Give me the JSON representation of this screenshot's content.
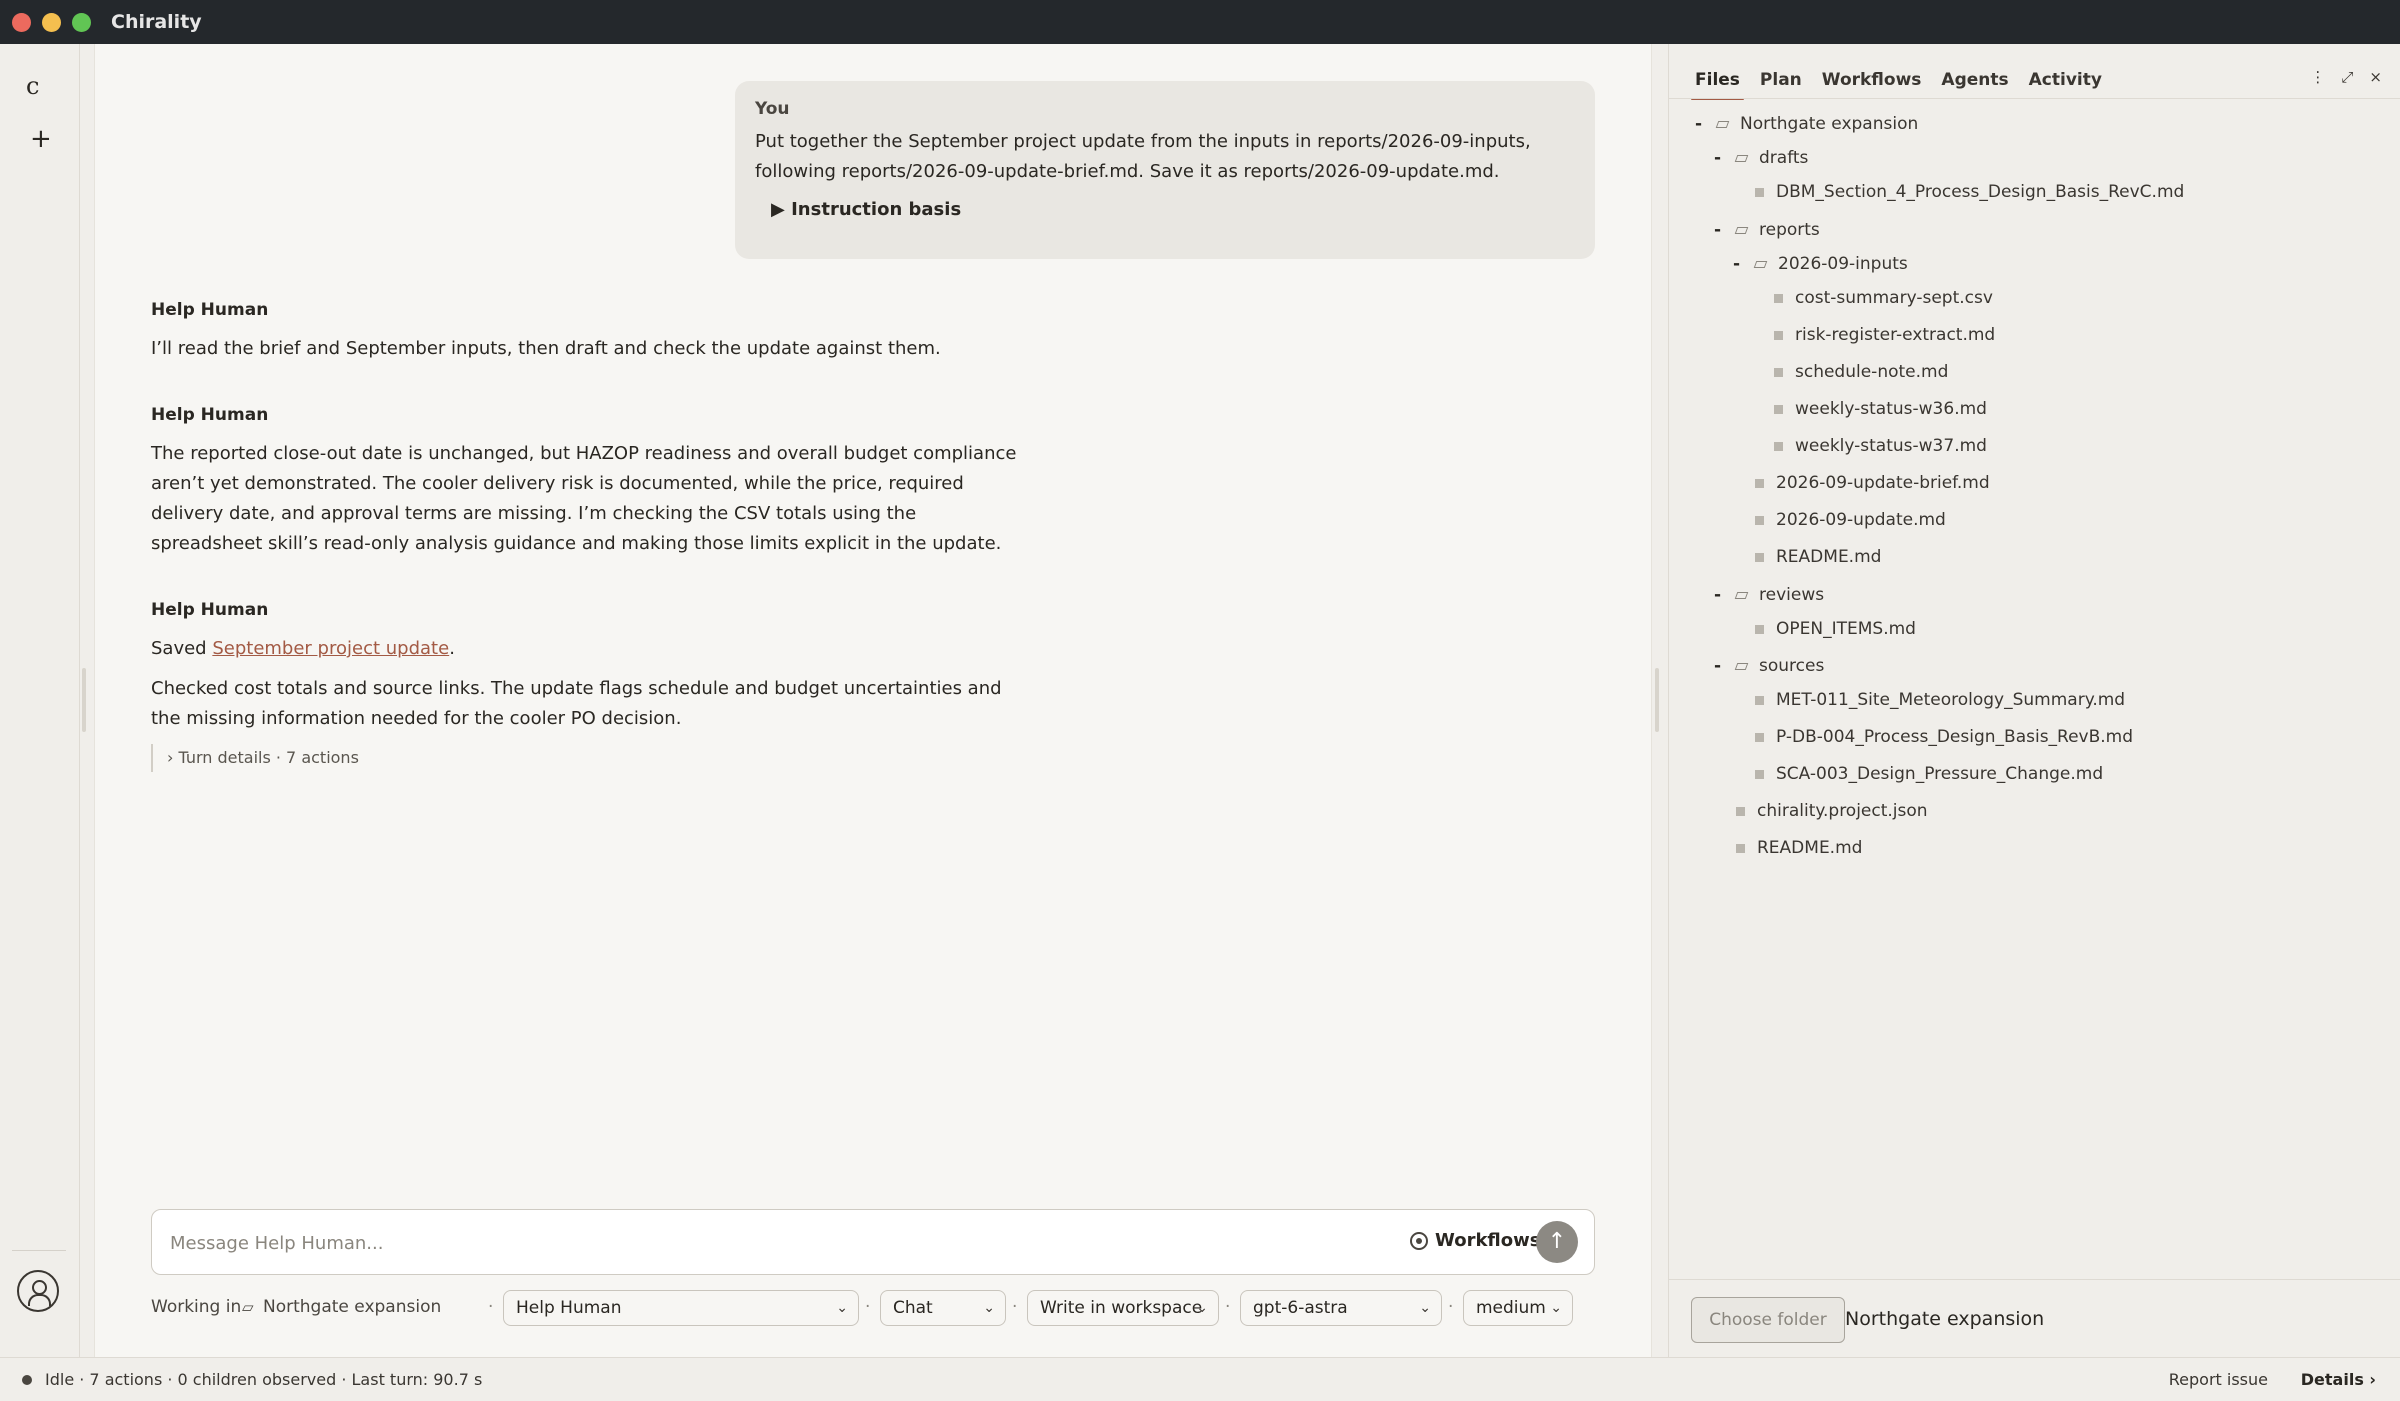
{
  "app": {
    "title": "Chirality"
  },
  "rail": {
    "logo": "ϲ",
    "new": "+"
  },
  "chat": {
    "user": {
      "name": "You",
      "text": "Put together the September project update from the inputs in reports/2026-09-inputs, following reports/2026-09-update-brief.md. Save it as reports/2026-09-update.md.",
      "basis": "▶ Instruction basis"
    },
    "messages": [
      {
        "name": "Help Human",
        "text": "I’ll read the brief and September inputs, then draft and check the update against them."
      },
      {
        "name": "Help Human",
        "text": "The reported close-out date is unchanged, but HAZOP readiness and overall budget compliance aren’t yet demonstrated. The cooler delivery risk is documented, while the price, required delivery date, and approval terms are missing. I’m checking the CSV totals using the spreadsheet skill’s read-only analysis guidance and making those limits explicit in the update."
      },
      {
        "name": "Help Human",
        "saved_prefix": "Saved ",
        "saved_link": "September project update",
        "saved_suffix": ".",
        "text": "Checked cost totals and source links. The update flags schedule and budget uncertainties and the missing information needed for the cooler PO decision.",
        "details": "›  Turn details · 7 actions"
      }
    ]
  },
  "composer": {
    "placeholder": "Message Help Human...",
    "workflows": "Workflows",
    "send": "↑"
  },
  "controls": {
    "working_in_label": "Working in",
    "project_icon": "▱",
    "project": "Northgate expansion",
    "agent": "Help Human",
    "mode": "Chat",
    "permission": "Write in workspace",
    "model": "gpt-6-astra",
    "effort": "medium",
    "separator": "·"
  },
  "panel": {
    "tabs": [
      {
        "label": "Files",
        "active": true
      },
      {
        "label": "Plan"
      },
      {
        "label": "Workflows"
      },
      {
        "label": "Agents"
      },
      {
        "label": "Activity"
      }
    ],
    "icons": {
      "more": "⋮",
      "expand": "⤢",
      "close": "×"
    },
    "tree": [
      {
        "label": "Northgate expansion",
        "type": "folder",
        "depth": 0
      },
      {
        "label": "drafts",
        "type": "folder",
        "depth": 1
      },
      {
        "label": "DBM_Section_4_Process_Design_Basis_RevC.md",
        "type": "file",
        "depth": 2
      },
      {
        "label": "reports",
        "type": "folder",
        "depth": 1
      },
      {
        "label": "2026-09-inputs",
        "type": "folder",
        "depth": 2
      },
      {
        "label": "cost-summary-sept.csv",
        "type": "file",
        "depth": 3
      },
      {
        "label": "risk-register-extract.md",
        "type": "file",
        "depth": 3
      },
      {
        "label": "schedule-note.md",
        "type": "file",
        "depth": 3
      },
      {
        "label": "weekly-status-w36.md",
        "type": "file",
        "depth": 3
      },
      {
        "label": "weekly-status-w37.md",
        "type": "file",
        "depth": 3
      },
      {
        "label": "2026-09-update-brief.md",
        "type": "file",
        "depth": 2
      },
      {
        "label": "2026-09-update.md",
        "type": "file",
        "depth": 2
      },
      {
        "label": "README.md",
        "type": "file",
        "depth": 2
      },
      {
        "label": "reviews",
        "type": "folder",
        "depth": 1
      },
      {
        "label": "OPEN_ITEMS.md",
        "type": "file",
        "depth": 2
      },
      {
        "label": "sources",
        "type": "folder",
        "depth": 1
      },
      {
        "label": "MET-011_Site_Meteorology_Summary.md",
        "type": "file",
        "depth": 2
      },
      {
        "label": "P-DB-004_Process_Design_Basis_RevB.md",
        "type": "file",
        "depth": 2
      },
      {
        "label": "SCA-003_Design_Pressure_Change.md",
        "type": "file",
        "depth": 2
      },
      {
        "label": "chirality.project.json",
        "type": "file",
        "depth": 1
      },
      {
        "label": "README.md",
        "type": "file",
        "depth": 1
      }
    ],
    "footer": {
      "choose_folder": "Choose folder",
      "folder_name": "Northgate expansion"
    }
  },
  "status": {
    "text": "Idle · 7 actions · 0 children observed · Last turn: 90.7 s",
    "report_issue": "Report issue",
    "details": "Details ›"
  }
}
